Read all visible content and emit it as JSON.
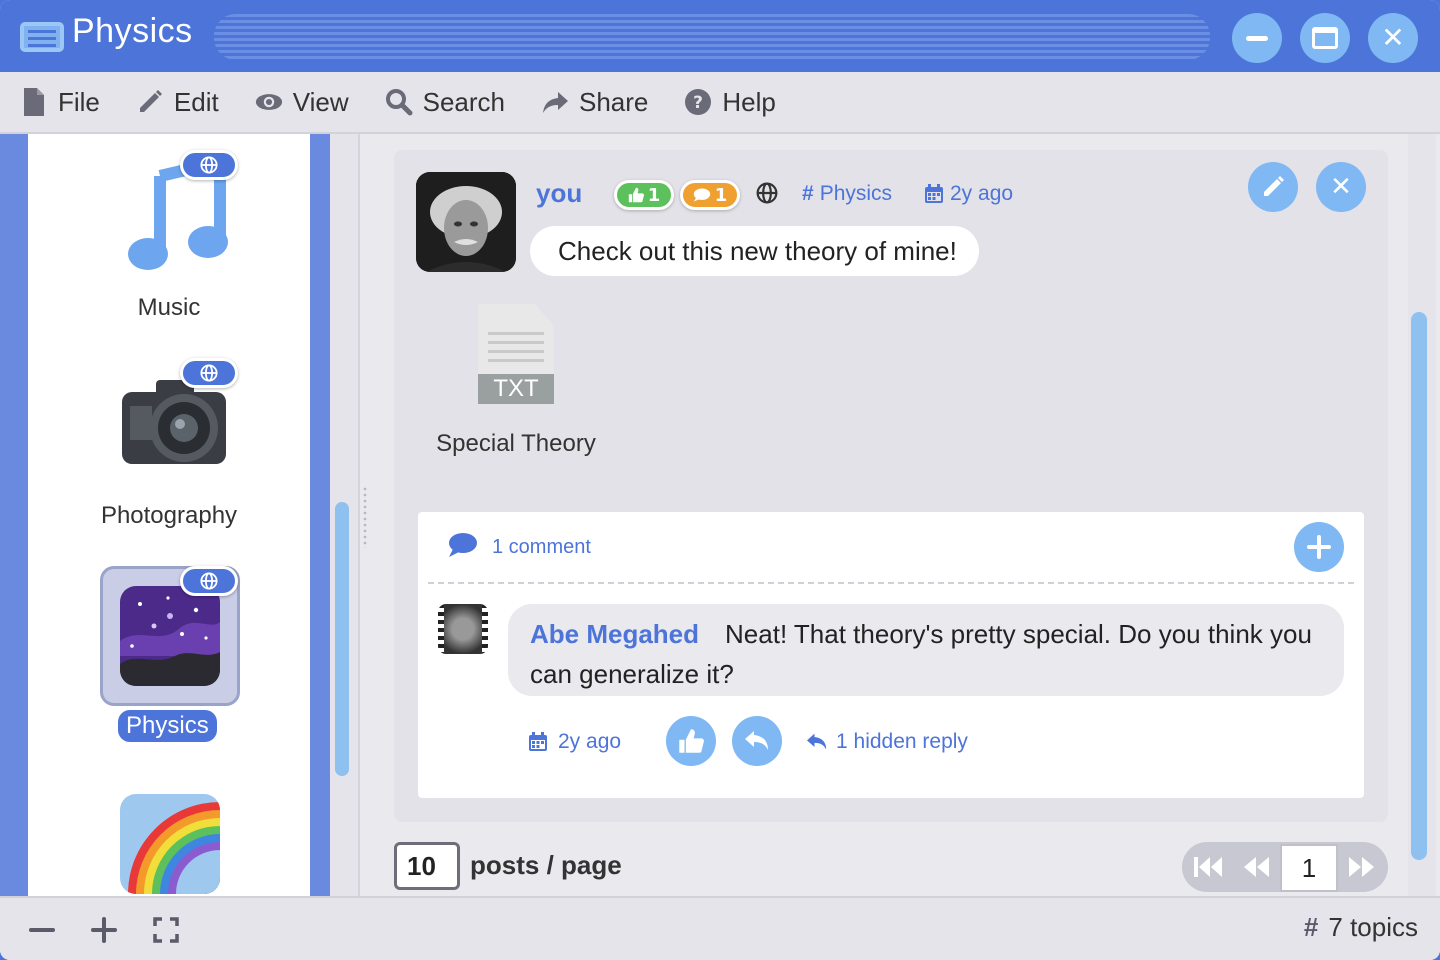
{
  "window": {
    "title": "Physics",
    "accent": "#4c74d9"
  },
  "menu": [
    {
      "label": "File",
      "icon": "file-icon"
    },
    {
      "label": "Edit",
      "icon": "pencil-icon"
    },
    {
      "label": "View",
      "icon": "eye-icon"
    },
    {
      "label": "Search",
      "icon": "search-icon"
    },
    {
      "label": "Share",
      "icon": "share-icon"
    },
    {
      "label": "Help",
      "icon": "help-icon"
    }
  ],
  "sidebar": {
    "topics": [
      {
        "label": "Music",
        "icon": "music-note-icon",
        "public": true,
        "selected": false
      },
      {
        "label": "Photography",
        "icon": "camera-icon",
        "public": true,
        "selected": false
      },
      {
        "label": "Physics",
        "icon": "galaxy-icon",
        "public": true,
        "selected": true
      },
      {
        "label": "",
        "icon": "rainbow-icon",
        "public": false,
        "selected": false
      }
    ]
  },
  "post": {
    "author": "you",
    "likes": "1",
    "comments": "1",
    "topic": "Physics",
    "time": "2y ago",
    "text": "Check out this new theory of mine!",
    "attachment": {
      "ext": "TXT",
      "name": "Special Theory"
    }
  },
  "comments": {
    "count_label": "1 comment",
    "items": [
      {
        "author": "Abe Megahed",
        "text": "Neat! That theory's pretty special. Do you think you can generalize it?",
        "time": "2y ago",
        "hidden_replies": "1 hidden reply"
      }
    ]
  },
  "pagination": {
    "per_page": "10",
    "per_page_label": "posts / page",
    "current_page": "1"
  },
  "status": {
    "topics_label": "7 topics"
  }
}
